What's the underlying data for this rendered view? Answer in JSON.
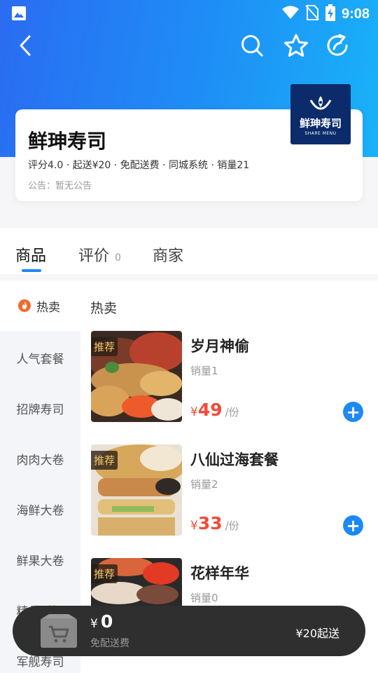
{
  "status_bar": {
    "time": "9:08"
  },
  "store": {
    "name": "鲜珅寿司",
    "meta": "评分4.0 · 起送¥20 · 免配送费 · 同城系统 · 销量21",
    "notice": "公告：暂无公告",
    "logo_text": "鲜珅寿司",
    "logo_sub": "SHARE MENU"
  },
  "tabs": [
    {
      "label": "商品",
      "active": true
    },
    {
      "label": "评价",
      "count": "0"
    },
    {
      "label": "商家"
    }
  ],
  "sidebar": {
    "hot_label": "热卖",
    "items": [
      "人气套餐",
      "招牌寿司",
      "肉肉大卷",
      "海鲜大卷",
      "鲜果大卷",
      "精品手握",
      "军舰寿司"
    ]
  },
  "section_title": "热卖",
  "products": [
    {
      "name": "岁月神偷",
      "sales": "销量1",
      "currency": "¥",
      "price": "49",
      "unit": "/份",
      "badge": "推荐"
    },
    {
      "name": "八仙过海套餐",
      "sales": "销量2",
      "currency": "¥",
      "price": "33",
      "unit": "/份",
      "badge": "推荐"
    },
    {
      "name": "花样年华",
      "sales": "销量0",
      "badge": "推荐"
    }
  ],
  "cart": {
    "currency": "¥",
    "amount": "0",
    "delivery": "免配送费",
    "min_order": "¥20起送"
  },
  "colors": {
    "accent": "#1e88f5",
    "price": "#f24a3a",
    "cart_bg": "#2f2f2f"
  }
}
